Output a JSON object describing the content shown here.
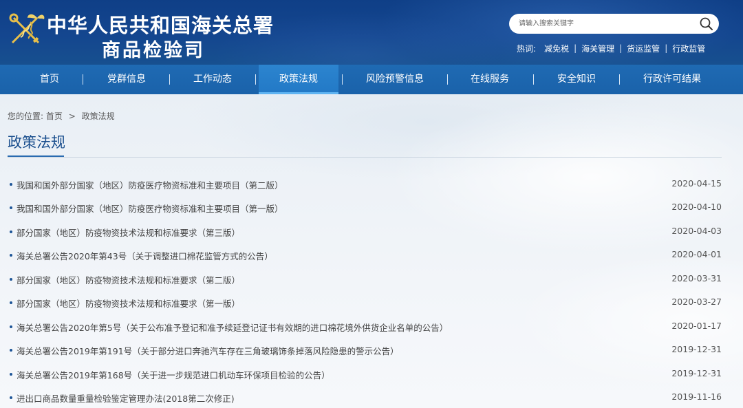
{
  "header": {
    "title_line1": "中华人民共和国海关总署",
    "title_line2": "商品检验司",
    "search": {
      "placeholder": "请输入搜索关键字"
    },
    "hot_label": "热词:",
    "hot_words": [
      "减免税",
      "海关管理",
      "货运监管",
      "行政监管"
    ],
    "brand_color": "#14468f"
  },
  "nav": {
    "items": [
      "首页",
      "党群信息",
      "工作动态",
      "政策法规",
      "风险预警信息",
      "在线服务",
      "安全知识",
      "行政许可结果"
    ],
    "active": "政策法规",
    "color": "#1f6ab3",
    "active_color": "#2c84cf"
  },
  "breadcrumb": {
    "prefix": "您的位置:",
    "home": "首页",
    "separator": ">",
    "current": "政策法规"
  },
  "page_title": "政策法规",
  "news": [
    {
      "title": "我国和国外部分国家（地区）防疫医疗物资标准和主要项目（第二版）",
      "date": "2020-04-15"
    },
    {
      "title": "我国和国外部分国家（地区）防疫医疗物资标准和主要项目（第一版）",
      "date": "2020-04-10"
    },
    {
      "title": "部分国家（地区）防疫物资技术法规和标准要求（第三版）",
      "date": "2020-04-03"
    },
    {
      "title": "海关总署公告2020年第43号（关于调整进口棉花监管方式的公告）",
      "date": "2020-04-01"
    },
    {
      "title": "部分国家（地区）防疫物资技术法规和标准要求（第二版）",
      "date": "2020-03-31"
    },
    {
      "title": "部分国家（地区）防疫物资技术法规和标准要求（第一版）",
      "date": "2020-03-27"
    },
    {
      "title": "海关总署公告2020年第5号（关于公布准予登记和准予续延登记证书有效期的进口棉花境外供货企业名单的公告）",
      "date": "2020-01-17"
    },
    {
      "title": "海关总署公告2019年第191号（关于部分进口奔驰汽车存在三角玻璃饰条掉落风险隐患的警示公告）",
      "date": "2019-12-31"
    },
    {
      "title": "海关总署公告2019年第168号（关于进一步规范进口机动车环保项目检验的公告）",
      "date": "2019-12-31"
    },
    {
      "title": "进出口商品数量重量检验鉴定管理办法(2018第二次修正)",
      "date": "2019-11-16"
    }
  ],
  "icons": {
    "emblem": "customs-emblem-icon",
    "search": "search-icon",
    "bullet": "bullet-dot-icon"
  }
}
